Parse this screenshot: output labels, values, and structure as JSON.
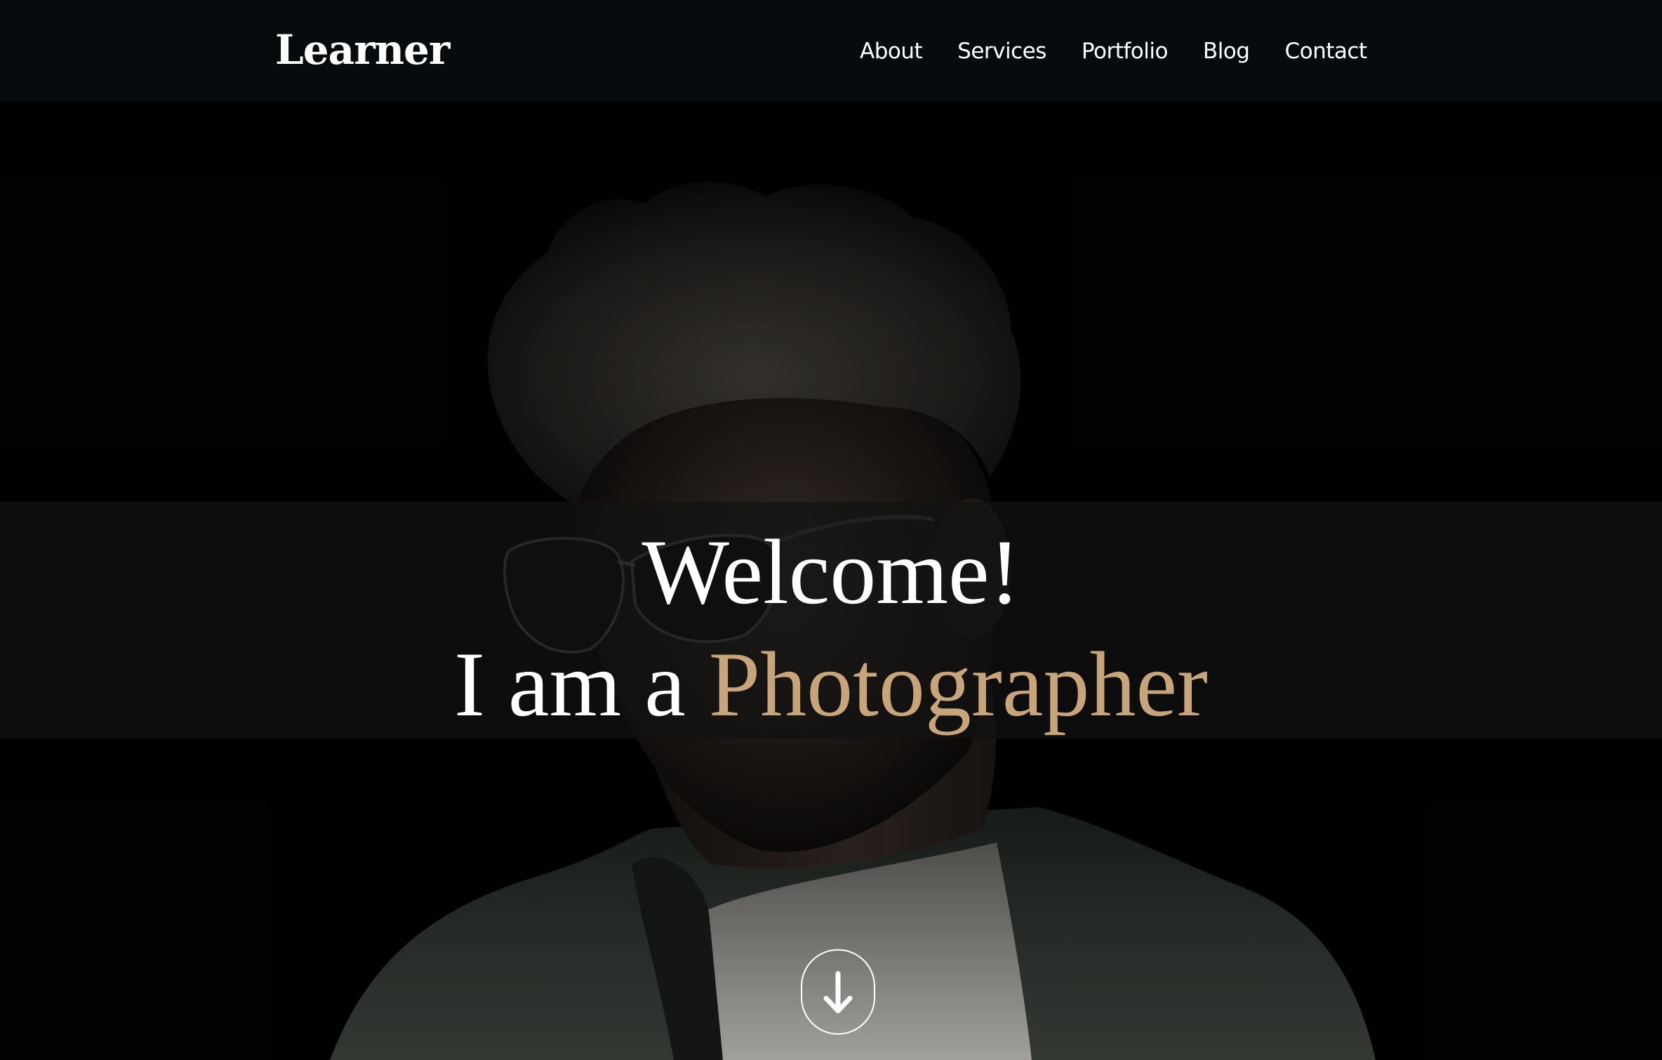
{
  "header": {
    "brand": "Learner",
    "nav": [
      {
        "label": "About"
      },
      {
        "label": "Services"
      },
      {
        "label": "Portfolio"
      },
      {
        "label": "Blog"
      },
      {
        "label": "Contact"
      }
    ]
  },
  "hero": {
    "title": "Welcome!",
    "subtitle_prefix": "I am a ",
    "subtitle_highlight": "Photographer",
    "scroll_icon": "arrow-down-icon"
  },
  "colors": {
    "navbar_bg": "#070b0d",
    "accent": "#c7a47a",
    "text": "#ffffff"
  }
}
